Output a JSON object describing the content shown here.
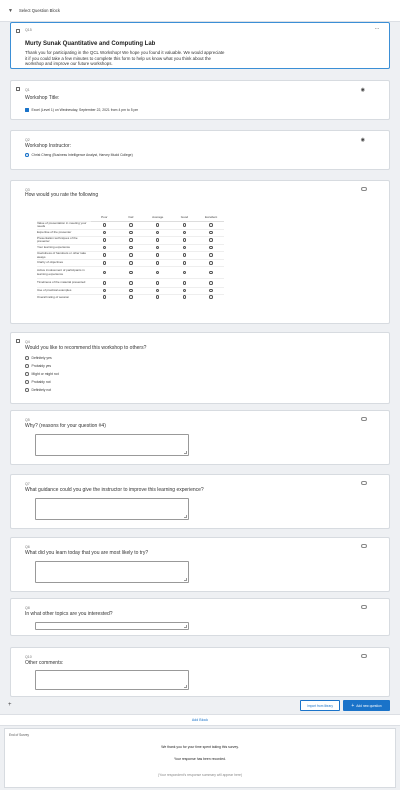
{
  "block": {
    "title": "Select Question Block"
  },
  "intro": {
    "qid": "Q15",
    "title": "Murty Sunak Quantitative and Computing Lab",
    "body": "Thank you for participating in the QCL Workshop! We hope you found it valuable. We would appreciate it if you could take a few minutes to complete this form to help us know what you think about the workshop and improve our future workshops."
  },
  "q1": {
    "qid": "Q1",
    "text": "Workshop Title:",
    "option": "Excel (Level 1) on Wednesday, September 22, 2021 from 4 pm to 5 pm"
  },
  "q2": {
    "qid": "Q2",
    "text": "Workshop Instructor:",
    "option": "Christ Cheng (Business Intelligence Analyst, Harvey Mudd College)"
  },
  "q3": {
    "qid": "Q3",
    "text": "How would you rate the following",
    "columns": [
      "Poor",
      "Fair",
      "Average",
      "Good",
      "Excellent"
    ],
    "rows": [
      "Value of presentation in meeting your needs",
      "Expertise of the presenter",
      "Presentation techniques of the presenter",
      "Your learning experience",
      "Usefulness of handouts or other take aways",
      "Clarity of objectives",
      "Active involvement of participants in learning experience",
      "Timeliness of the material presented",
      "Use of practical examples",
      "Overall rating of session"
    ]
  },
  "q4": {
    "qid": "Q4",
    "text": "Would you like to recommend this workshop to others?",
    "options": [
      "Definitely yes",
      "Probably yes",
      "Might or might not",
      "Probably not",
      "Definitely not"
    ]
  },
  "q5": {
    "qid": "Q5",
    "text": "Why? (reasons for your question #4)"
  },
  "q7": {
    "qid": "Q7",
    "text": "What guidance could you give the instructor to improve this learning experience?"
  },
  "q6": {
    "qid": "Q6",
    "text": "What did you learn today that you are most likely to try?"
  },
  "q8": {
    "qid": "Q8",
    "text": "In what other topics are you interested?"
  },
  "q10": {
    "qid": "Q10",
    "text": "Other comments:"
  },
  "actions": {
    "import_label": "Import from library",
    "add_label": "Add new question",
    "add_block_label": "Add Block"
  },
  "end_of_survey": {
    "label": "End of Survey",
    "line1": "We thank you for your time spent taking this survey.",
    "line2": "Your response has been recorded.",
    "line3": "(Your respondent's response summary will appear here)"
  },
  "colors": {
    "accent": "#1a73c9",
    "border_selected": "#3b8fd6"
  }
}
